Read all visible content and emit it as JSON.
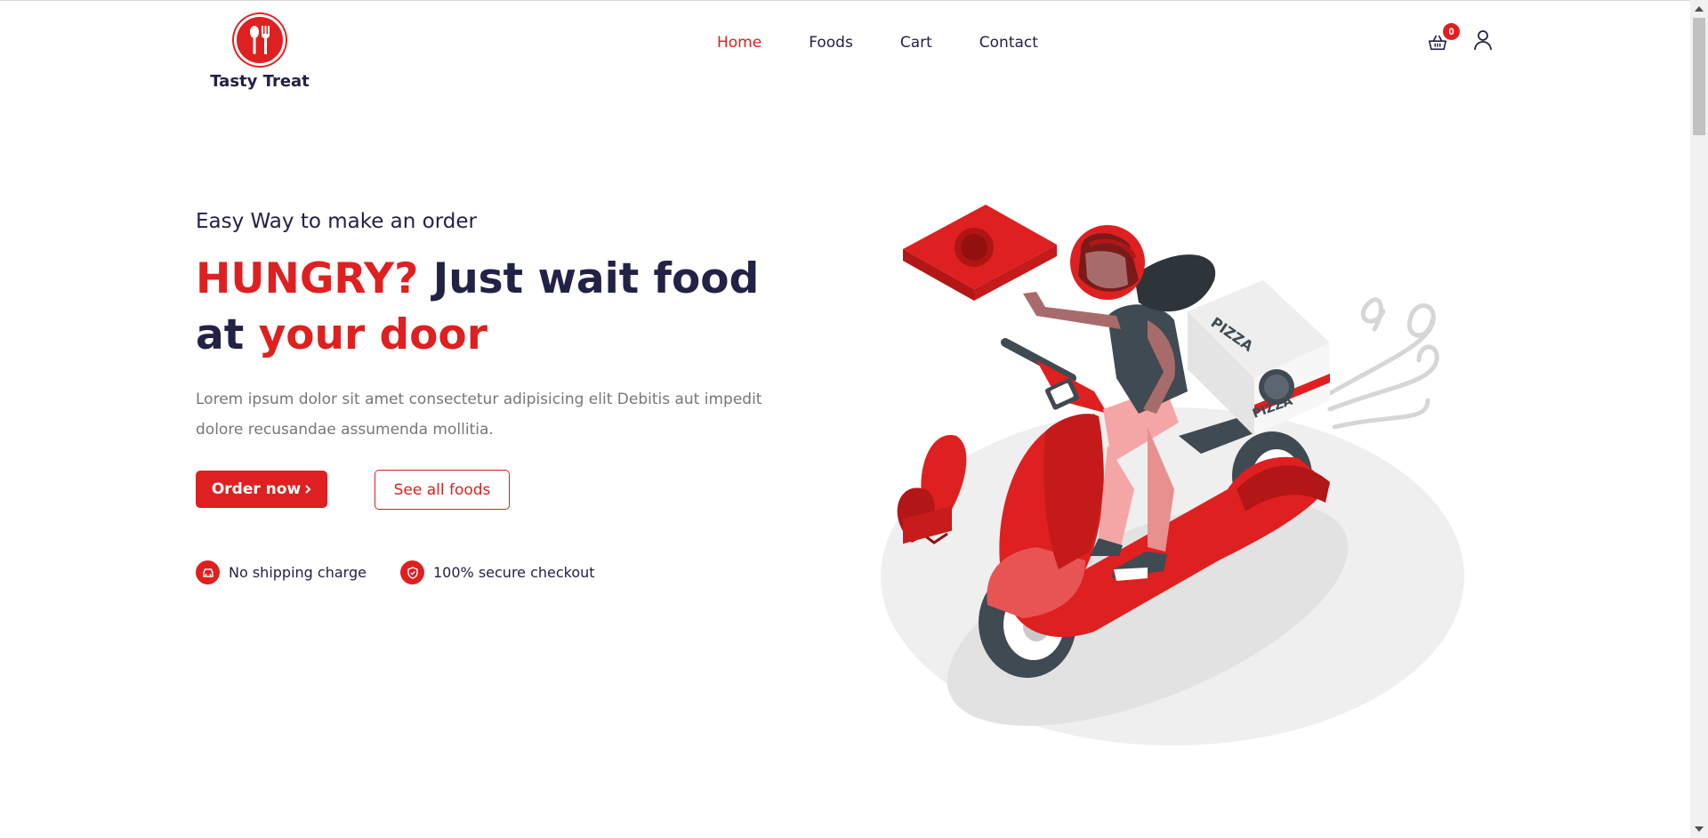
{
  "brand": {
    "name": "Tasty Treat",
    "accent": "#df2020",
    "text": "#212245"
  },
  "nav": {
    "items": [
      {
        "label": "Home",
        "active": true
      },
      {
        "label": "Foods",
        "active": false
      },
      {
        "label": "Cart",
        "active": false
      },
      {
        "label": "Contact",
        "active": false
      }
    ]
  },
  "header": {
    "cart_count": "0",
    "cart_icon": "shopping-basket-icon",
    "user_icon": "user-icon"
  },
  "hero": {
    "subtitle": "Easy Way to make an order",
    "headline_red": "HUNGRY?",
    "headline_dark": "Just wait food at",
    "headline_red2": "your door",
    "description": "Lorem ipsum dolor sit amet consectetur adipisicing elit Debitis aut impedit dolore recusandae assumenda mollitia.",
    "order_button": "Order now",
    "order_button_icon": "chevron-right-icon",
    "see_all_button": "See all foods",
    "features": [
      {
        "label": "No shipping charge",
        "icon": "car-icon"
      },
      {
        "label": "100% secure checkout",
        "icon": "shield-check-icon"
      }
    ],
    "illustration_text": "PIZZA"
  }
}
